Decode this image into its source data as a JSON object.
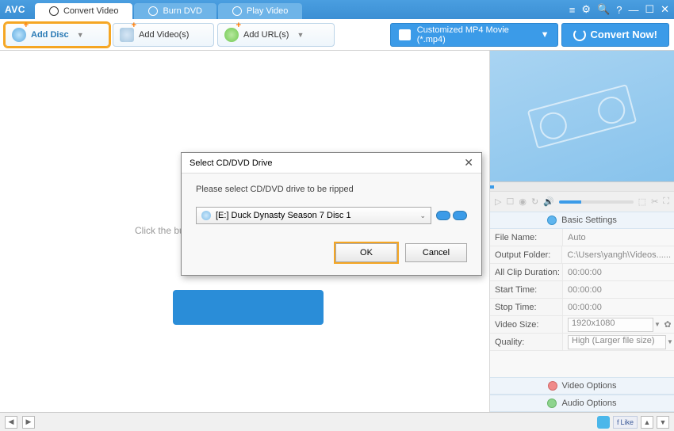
{
  "app": {
    "logo": "AVC"
  },
  "tabs": {
    "convert": "Convert Video",
    "burn": "Burn DVD",
    "play": "Play Video"
  },
  "toolbar": {
    "add_disc": "Add Disc",
    "add_videos": "Add Video(s)",
    "add_urls": "Add URL(s)",
    "profile": "Customized MP4 Movie (*.mp4)",
    "convert": "Convert Now!"
  },
  "content": {
    "hint": "Click the bu"
  },
  "dialog": {
    "title": "Select CD/DVD Drive",
    "message": "Please select CD/DVD drive to be ripped",
    "drive": "[E:] Duck Dynasty Season 7 Disc 1",
    "ok": "OK",
    "cancel": "Cancel"
  },
  "settings": {
    "header_basic": "Basic Settings",
    "file_name_k": "File Name:",
    "file_name_v": "Auto",
    "output_folder_k": "Output Folder:",
    "output_folder_v": "C:\\Users\\yangh\\Videos...",
    "all_clip_k": "All Clip Duration:",
    "all_clip_v": "00:00:00",
    "start_k": "Start Time:",
    "start_v": "00:00:00",
    "stop_k": "Stop Time:",
    "stop_v": "00:00:00",
    "video_size_k": "Video Size:",
    "video_size_v": "1920x1080",
    "quality_k": "Quality:",
    "quality_v": "High (Larger file size)",
    "header_video": "Video Options",
    "header_audio": "Audio Options"
  },
  "statusbar": {
    "like": "Like"
  }
}
